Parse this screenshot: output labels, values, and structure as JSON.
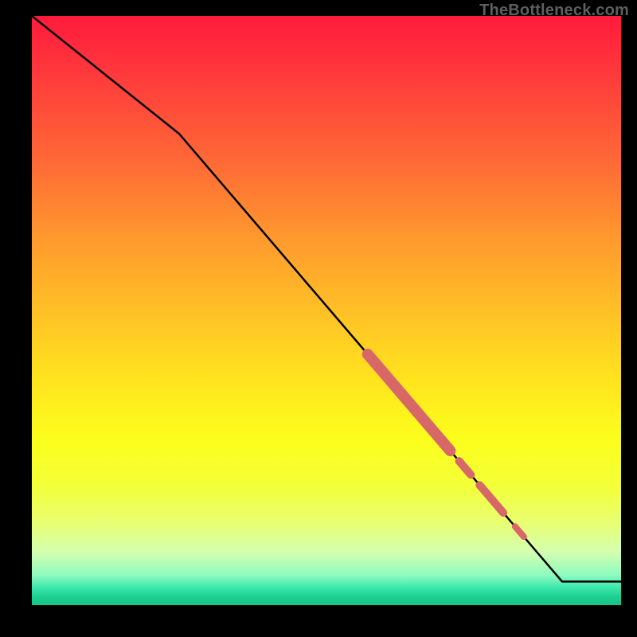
{
  "watermark": "TheBottleneck.com",
  "colors": {
    "curve": "#000000",
    "highlight": "#d86868",
    "gradient_top": "#ff1a3c",
    "gradient_bottom": "#16c488"
  },
  "chart_data": {
    "type": "line",
    "title": "",
    "xlabel": "",
    "ylabel": "",
    "xlim": [
      0,
      100
    ],
    "ylim": [
      0,
      100
    ],
    "grid": false,
    "legend": false,
    "series": [
      {
        "name": "curve",
        "x": [
          0,
          25,
          90,
          100
        ],
        "values": [
          100,
          80,
          4,
          4
        ]
      }
    ],
    "highlight_segments": [
      {
        "x_range": [
          57,
          71
        ],
        "thickness": "thick"
      },
      {
        "x_range": [
          72.5,
          74.5
        ],
        "thickness": "medium"
      },
      {
        "x_range": [
          76,
          80
        ],
        "thickness": "medium"
      },
      {
        "x_range": [
          82,
          83.5
        ],
        "thickness": "small"
      }
    ]
  }
}
